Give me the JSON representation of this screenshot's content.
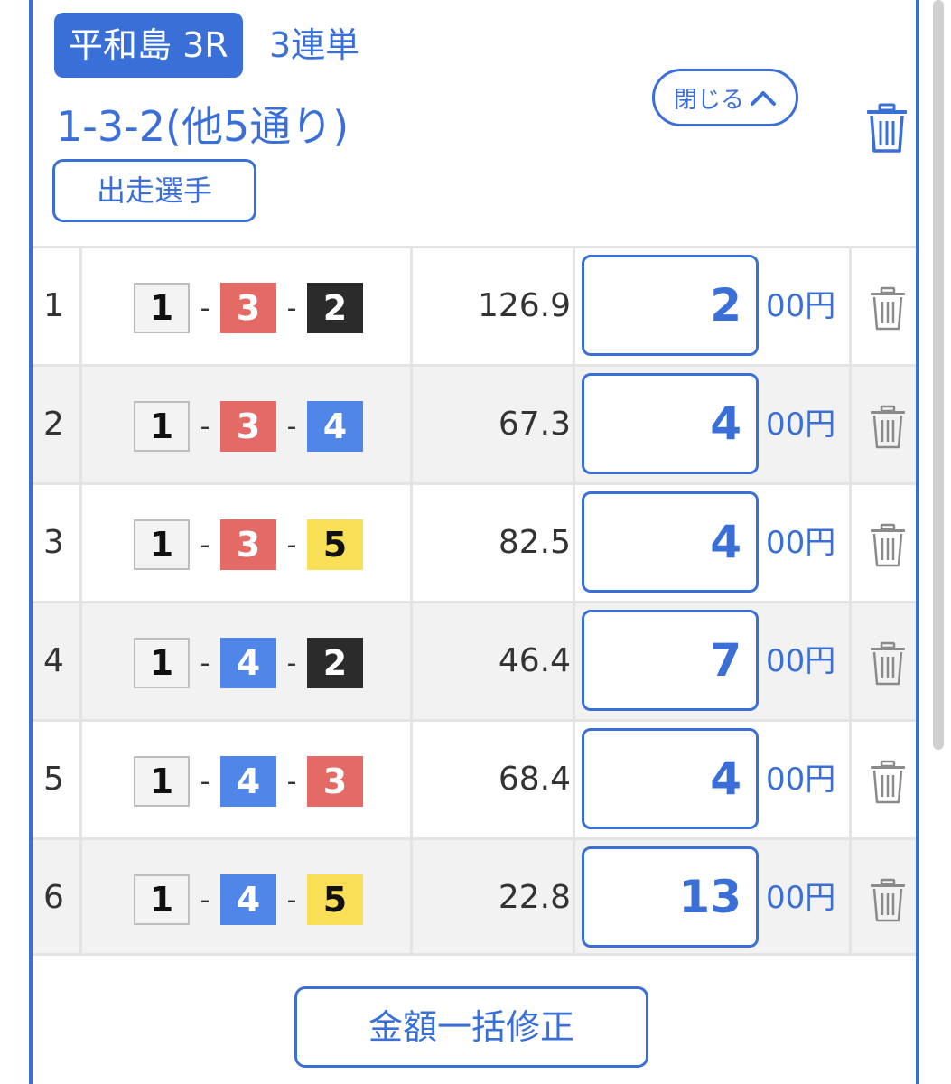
{
  "header": {
    "race": "平和島 3R",
    "bet_type": "3連単",
    "combo_summary": "1-3-2(他5通り)",
    "runners_button": "出走選手",
    "close_button": "閉じる"
  },
  "colors": {
    "accent": "#3a6fd8",
    "boat_1": "#f3f3f3",
    "boat_2": "#2b2b2b",
    "boat_3": "#e46a66",
    "boat_4": "#4f86e8",
    "boat_5": "#f8df55"
  },
  "icons": [
    "trash-icon",
    "chevron-up-icon"
  ],
  "rows": [
    {
      "no": "1",
      "first": "1",
      "second": "3",
      "third": "2",
      "odds": "126.9",
      "amount": "2",
      "unit": "00円"
    },
    {
      "no": "2",
      "first": "1",
      "second": "3",
      "third": "4",
      "odds": "67.3",
      "amount": "4",
      "unit": "00円"
    },
    {
      "no": "3",
      "first": "1",
      "second": "3",
      "third": "5",
      "odds": "82.5",
      "amount": "4",
      "unit": "00円"
    },
    {
      "no": "4",
      "first": "1",
      "second": "4",
      "third": "2",
      "odds": "46.4",
      "amount": "7",
      "unit": "00円"
    },
    {
      "no": "5",
      "first": "1",
      "second": "4",
      "third": "3",
      "odds": "68.4",
      "amount": "4",
      "unit": "00円"
    },
    {
      "no": "6",
      "first": "1",
      "second": "4",
      "third": "5",
      "odds": "22.8",
      "amount": "13",
      "unit": "00円"
    }
  ],
  "footer": {
    "bulk_edit_button": "金額一括修正"
  }
}
